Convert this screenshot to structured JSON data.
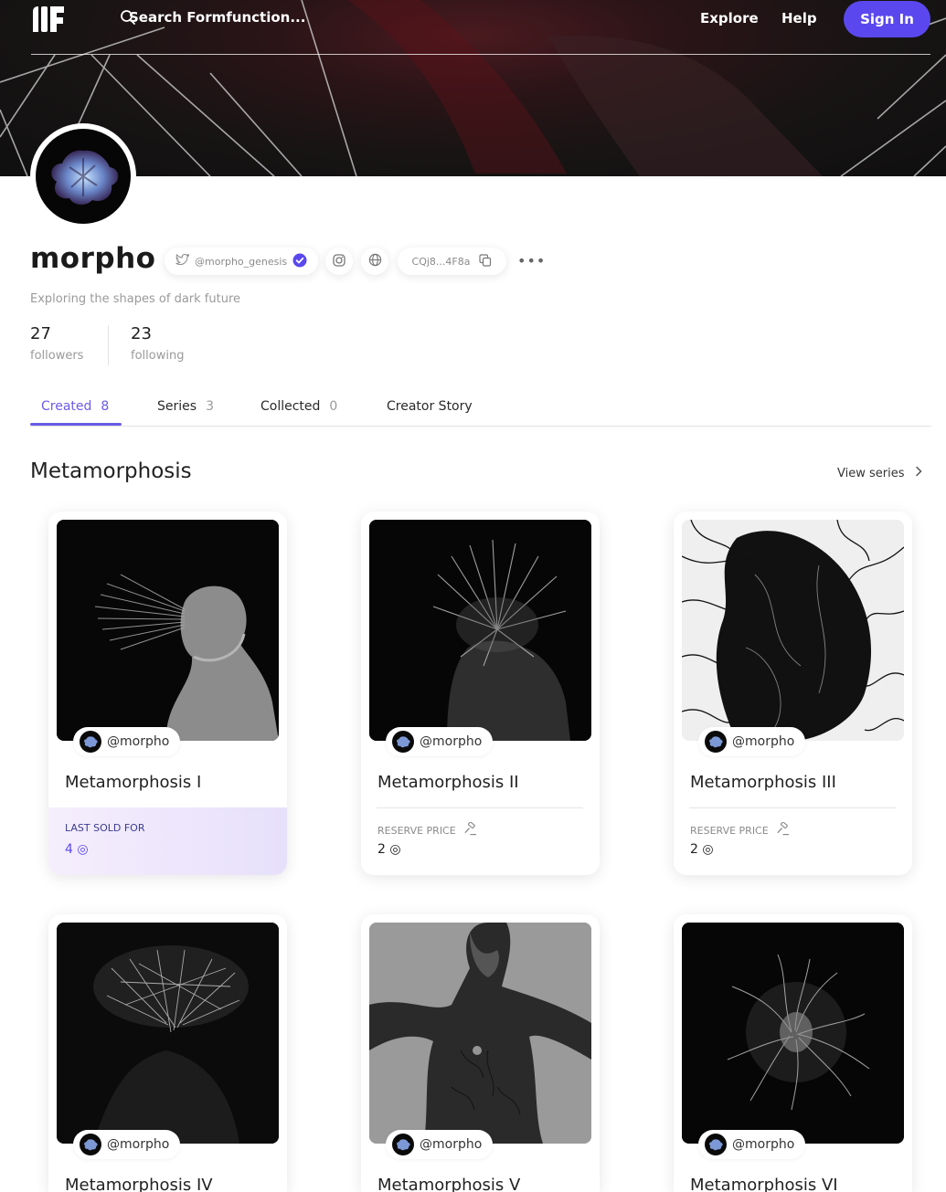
{
  "nav": {
    "search_placeholder": "Search Formfunction...",
    "explore": "Explore",
    "help": "Help",
    "sign_in": "Sign In"
  },
  "profile": {
    "username": "morpho",
    "twitter_handle": "@morpho_genesis",
    "wallet": "CQj8...4F8a",
    "bio": "Exploring the shapes of dark future",
    "followers_count": "27",
    "followers_label": "followers",
    "following_count": "23",
    "following_label": "following"
  },
  "tabs": [
    {
      "label": "Created",
      "count": "8"
    },
    {
      "label": "Series",
      "count": "3"
    },
    {
      "label": "Collected",
      "count": "0"
    },
    {
      "label": "Creator Story",
      "count": ""
    }
  ],
  "section": {
    "title": "Metamorphosis",
    "view_series": "View series"
  },
  "cards": [
    {
      "creator": "@morpho",
      "title": "Metamorphosis I",
      "price_label": "LAST SOLD FOR",
      "price": "4 ◎"
    },
    {
      "creator": "@morpho",
      "title": "Metamorphosis II",
      "price_label": "RESERVE PRICE",
      "price": "2 ◎"
    },
    {
      "creator": "@morpho",
      "title": "Metamorphosis III",
      "price_label": "RESERVE PRICE",
      "price": "2 ◎"
    },
    {
      "creator": "@morpho",
      "title": "Metamorphosis IV"
    },
    {
      "creator": "@morpho",
      "title": "Metamorphosis V"
    },
    {
      "creator": "@morpho",
      "title": "Metamorphosis VI"
    }
  ],
  "colors": {
    "accent": "#5a48ee",
    "tab_active": "#6b5ce7",
    "verified": "#5a48ee",
    "last_sold_label": "#3b3b8f",
    "reserve_label": "#8a8a8a"
  },
  "icons": [
    "logo-icon",
    "search-icon",
    "twitter-icon",
    "verified-icon",
    "instagram-icon",
    "globe-icon",
    "copy-icon",
    "more-icon",
    "chevron-right-icon",
    "gavel-icon"
  ]
}
